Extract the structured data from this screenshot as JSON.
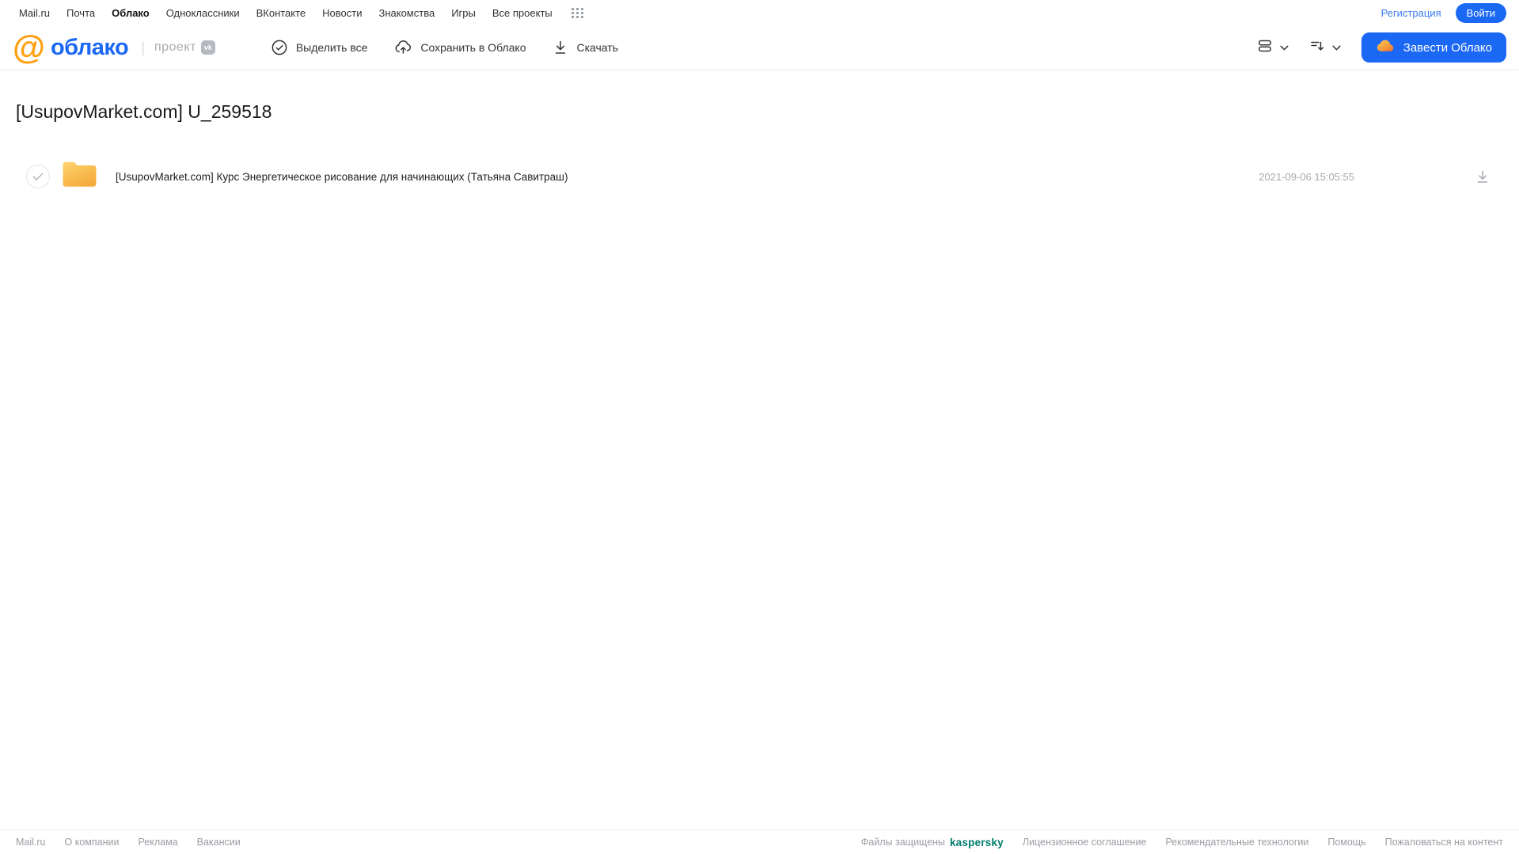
{
  "topnav": {
    "links": [
      "Mail.ru",
      "Почта",
      "Облако",
      "Одноклассники",
      "ВКонтакте",
      "Новости",
      "Знакомства",
      "Игры",
      "Все проекты"
    ],
    "registration": "Регистрация",
    "login": "Войти"
  },
  "header": {
    "logo_at": "@",
    "logo_text": "облако",
    "separator": "|",
    "project_label": "проект",
    "vk_badge": "vk",
    "actions": {
      "select_all": "Выделить все",
      "save_to_cloud": "Сохранить в Облако",
      "download": "Скачать"
    },
    "get_cloud": "Завести Облако"
  },
  "main": {
    "title": "[UsupovMarket.com] U_259518",
    "files": [
      {
        "type": "folder",
        "name": "[UsupovMarket.com] Курс Энергетическое рисование для начинающих (Татьяна Савитраш)",
        "date": "2021-09-06 15:05:55"
      }
    ]
  },
  "footer": {
    "links_left": [
      "Mail.ru",
      "О компании",
      "Реклама",
      "Вакансии"
    ],
    "protected_text": "Файлы защищены",
    "kaspersky": "kaspersky",
    "links_right": [
      "Лицензионное соглашение",
      "Рекомендательные технологии",
      "Помощь",
      "Пожаловаться на контент"
    ]
  },
  "colors": {
    "accent_blue": "#1b68f5",
    "logo_orange": "#ffa013",
    "kaspersky_teal": "#007d6d",
    "folder_top": "#ffd46e",
    "folder_bottom": "#f5ac3e"
  }
}
